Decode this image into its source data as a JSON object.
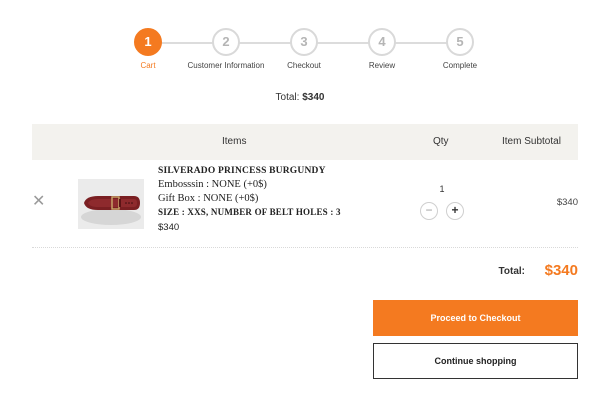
{
  "steps": [
    {
      "number": "1",
      "label": "Cart",
      "active": true
    },
    {
      "number": "2",
      "label": "Customer Information",
      "active": false
    },
    {
      "number": "3",
      "label": "Checkout",
      "active": false
    },
    {
      "number": "4",
      "label": "Review",
      "active": false
    },
    {
      "number": "5",
      "label": "Complete",
      "active": false
    }
  ],
  "summary": {
    "total_prefix": "Total:",
    "total_value": "$340"
  },
  "table": {
    "headers": {
      "items": "Items",
      "qty": "Qty",
      "subtotal": "Item Subtotal"
    }
  },
  "cart_item": {
    "remove_icon": "close-icon",
    "image_alt": "burgundy leather belt",
    "title": "SILVERADO PRINCESS BURGUNDY",
    "options": [
      "Embosssin : NONE (+0$)",
      "Gift Box : NONE (+0$)",
      "SIZE : XXS, NUMBER OF BELT HOLES : 3"
    ],
    "price": "$340",
    "quantity": "1",
    "minus_symbol": "−",
    "plus_symbol": "+",
    "subtotal": "$340"
  },
  "totals": {
    "label": "Total:",
    "value": "$340"
  },
  "buttons": {
    "checkout": "Proceed to Checkout",
    "continue": "Continue shopping"
  },
  "colors": {
    "accent": "#f47a20",
    "header_bg": "#f3f2ee"
  }
}
